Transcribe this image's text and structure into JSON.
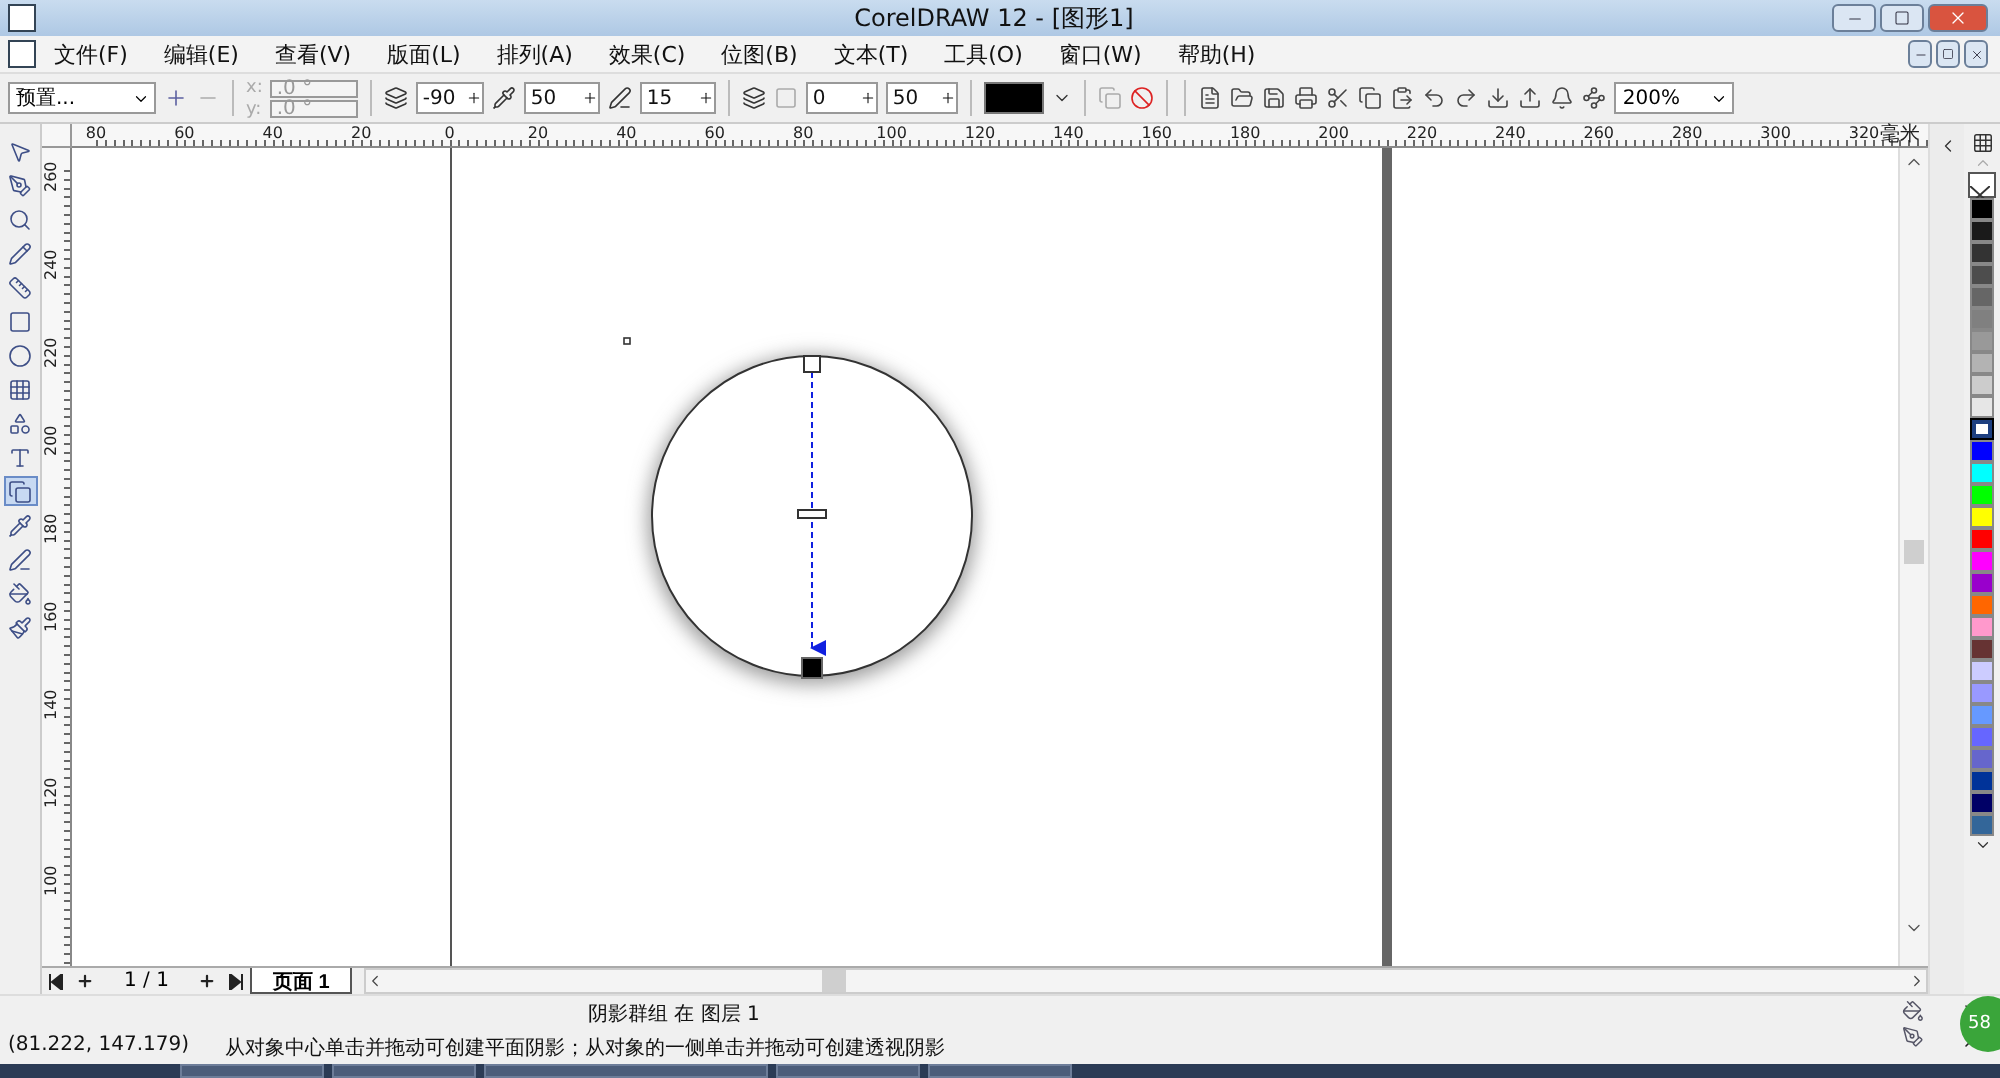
{
  "window": {
    "title": "CorelDRAW 12 - [图形1]"
  },
  "menu": [
    "文件(F)",
    "编辑(E)",
    "查看(V)",
    "版面(L)",
    "排列(A)",
    "效果(C)",
    "位图(B)",
    "文本(T)",
    "工具(O)",
    "窗口(W)",
    "帮助(H)"
  ],
  "property_bar": {
    "preset": "预置...",
    "x_label": "x:",
    "y_label": "y:",
    "x_value": ".0 °",
    "y_value": ".0 °",
    "angle": "-90",
    "opacity": "50",
    "feather": "15",
    "fade": "0",
    "stretch": "50",
    "zoom": "200%"
  },
  "toolbox": [
    {
      "selected": false
    },
    {
      "selected": false
    },
    {
      "selected": false
    },
    {
      "selected": false
    },
    {
      "selected": false
    },
    {
      "selected": false
    },
    {
      "selected": false
    },
    {
      "selected": false
    },
    {
      "selected": false
    },
    {
      "selected": false
    },
    {
      "selected": true
    },
    {
      "selected": false
    },
    {
      "selected": false
    },
    {
      "selected": false
    },
    {
      "selected": false
    }
  ],
  "rulers": {
    "unit": "毫米",
    "horizontal": [
      "80",
      "60",
      "40",
      "20",
      "0",
      "20",
      "40",
      "60",
      "80",
      "100",
      "120",
      "140",
      "160",
      "180",
      "200",
      "220",
      "240",
      "260",
      "280",
      "300",
      "320"
    ],
    "vertical": [
      "260",
      "240",
      "220",
      "200",
      "180",
      "160",
      "140",
      "120",
      "100"
    ]
  },
  "page_nav": {
    "count": "1 / 1",
    "tabs": [
      {
        "label": "页面 1",
        "selected": true
      }
    ]
  },
  "palette": [
    {
      "color": "#000000",
      "selected": false
    },
    {
      "color": "#1a1a1a",
      "selected": false
    },
    {
      "color": "#333333",
      "selected": false
    },
    {
      "color": "#4d4d4d",
      "selected": false
    },
    {
      "color": "#666666",
      "selected": false
    },
    {
      "color": "#808080",
      "selected": false
    },
    {
      "color": "#999999",
      "selected": false
    },
    {
      "color": "#b3b3b3",
      "selected": false
    },
    {
      "color": "#cccccc",
      "selected": false
    },
    {
      "color": "#e6e6e6",
      "selected": false
    },
    {
      "color": "#ffffff",
      "selected": true
    },
    {
      "color": "#0000ff",
      "selected": false
    },
    {
      "color": "#00ffff",
      "selected": false
    },
    {
      "color": "#00ff00",
      "selected": false
    },
    {
      "color": "#ffff00",
      "selected": false
    },
    {
      "color": "#ff0000",
      "selected": false
    },
    {
      "color": "#ff00ff",
      "selected": false
    },
    {
      "color": "#9900cc",
      "selected": false
    },
    {
      "color": "#ff6600",
      "selected": false
    },
    {
      "color": "#ff99cc",
      "selected": false
    },
    {
      "color": "#663333",
      "selected": false
    },
    {
      "color": "#ccccff",
      "selected": false
    },
    {
      "color": "#9999ff",
      "selected": false
    },
    {
      "color": "#6699ff",
      "selected": false
    },
    {
      "color": "#6666ff",
      "selected": false
    },
    {
      "color": "#6666cc",
      "selected": false
    },
    {
      "color": "#003399",
      "selected": false
    },
    {
      "color": "#000066",
      "selected": false
    },
    {
      "color": "#336699",
      "selected": false
    }
  ],
  "status_bar": {
    "object_info": "阴影群组 在 图层 1",
    "coordinates": "(81.222, 147.179)",
    "hint": "从对象中心单击并拖动可创建平面阴影；从对象的一侧单击并拖动可创建透视阴影",
    "badge": "58"
  }
}
